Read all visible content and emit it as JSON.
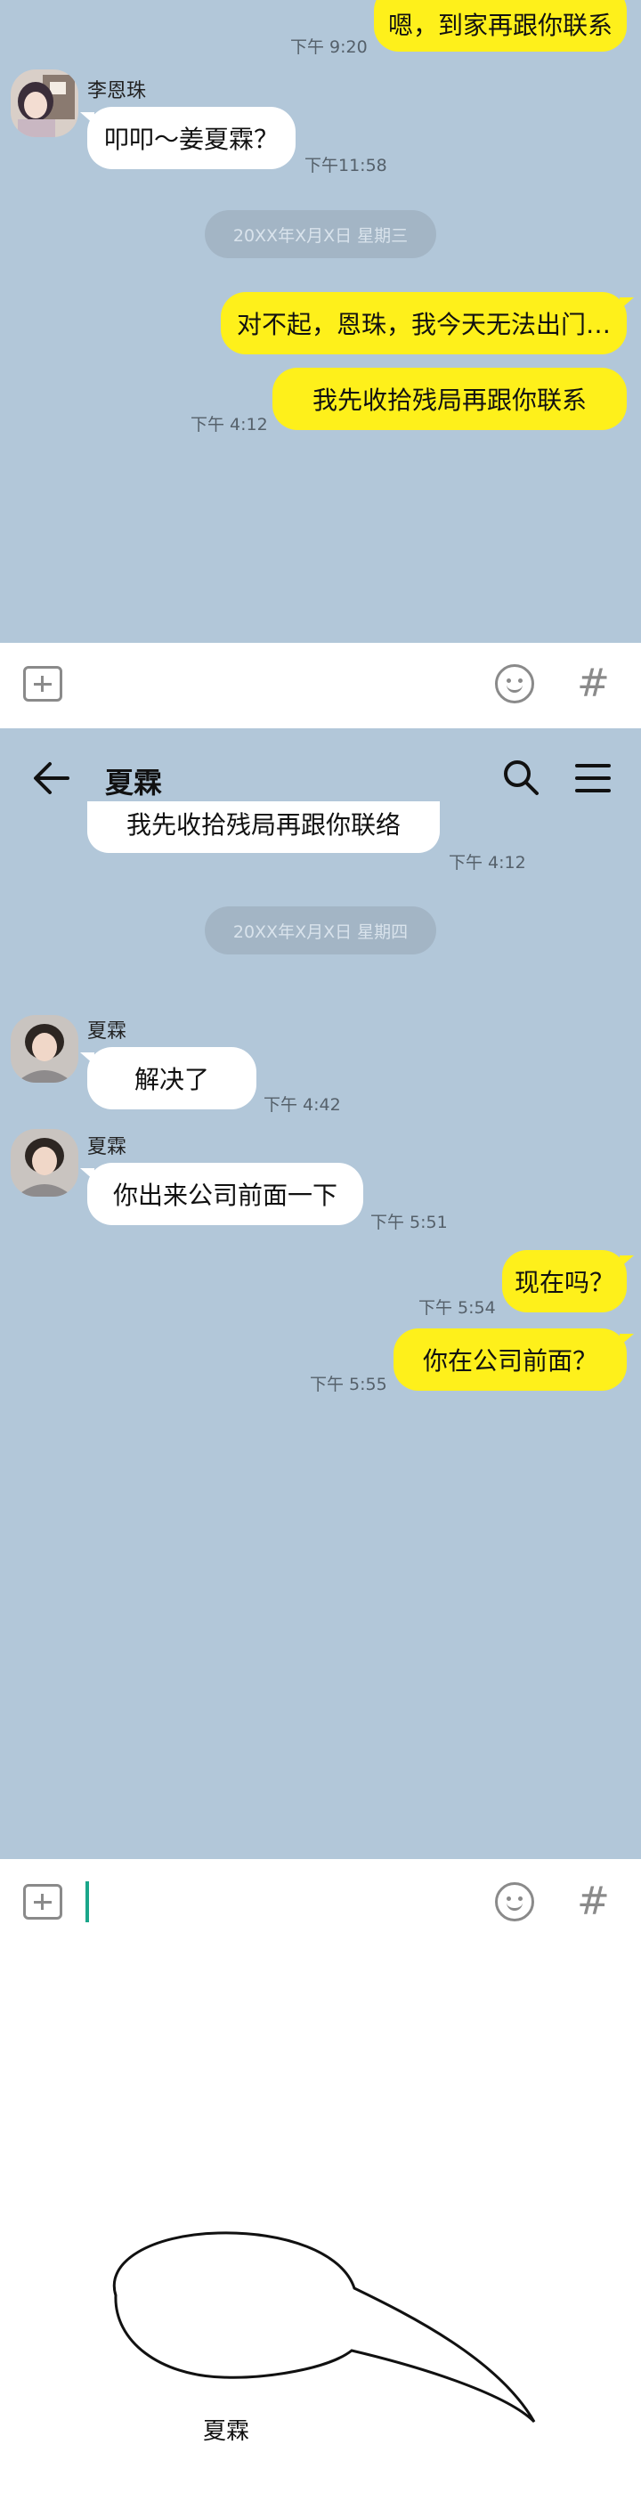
{
  "panel1": {
    "messages": [
      {
        "text": "嗯，到家再跟你联系",
        "time": "下午 9:20"
      },
      {
        "sender": "李恩珠",
        "text": "叩叩～姜夏霖？",
        "time": "下午11:58"
      },
      {
        "date": "20XX年X月X日 星期三"
      },
      {
        "text": "对不起，恩珠，我今天无法出门…"
      },
      {
        "text": "我先收拾残局再跟你联系",
        "time": "下午 4:12"
      }
    ]
  },
  "panel2": {
    "header": {
      "title": "夏霖",
      "back_icon": "back-arrow-icon",
      "search_icon": "search-icon",
      "menu_icon": "menu-icon"
    },
    "messages": [
      {
        "text": "我先收拾残局再跟你联络",
        "time": "下午 4:12"
      },
      {
        "date": "20XX年X月X日 星期四"
      },
      {
        "sender": "夏霖",
        "text": "解决了",
        "time": "下午 4:42"
      },
      {
        "sender": "夏霖",
        "text": "你出来公司前面一下",
        "time": "下午 5:51"
      },
      {
        "text": "现在吗？",
        "time": "下午 5:54"
      },
      {
        "text": "你在公司前面？",
        "time": "下午 5:55"
      }
    ]
  },
  "input_icons": {
    "attach": "plus-icon",
    "emoji": "emoji-icon",
    "tag": "hash-icon"
  },
  "hash_glyph": "#",
  "speech_bubble": {
    "text": "夏霖"
  },
  "colors": {
    "chat_bg": "#b2c7d9",
    "my_bubble": "#fef01b",
    "other_bubble": "#ffffff"
  }
}
